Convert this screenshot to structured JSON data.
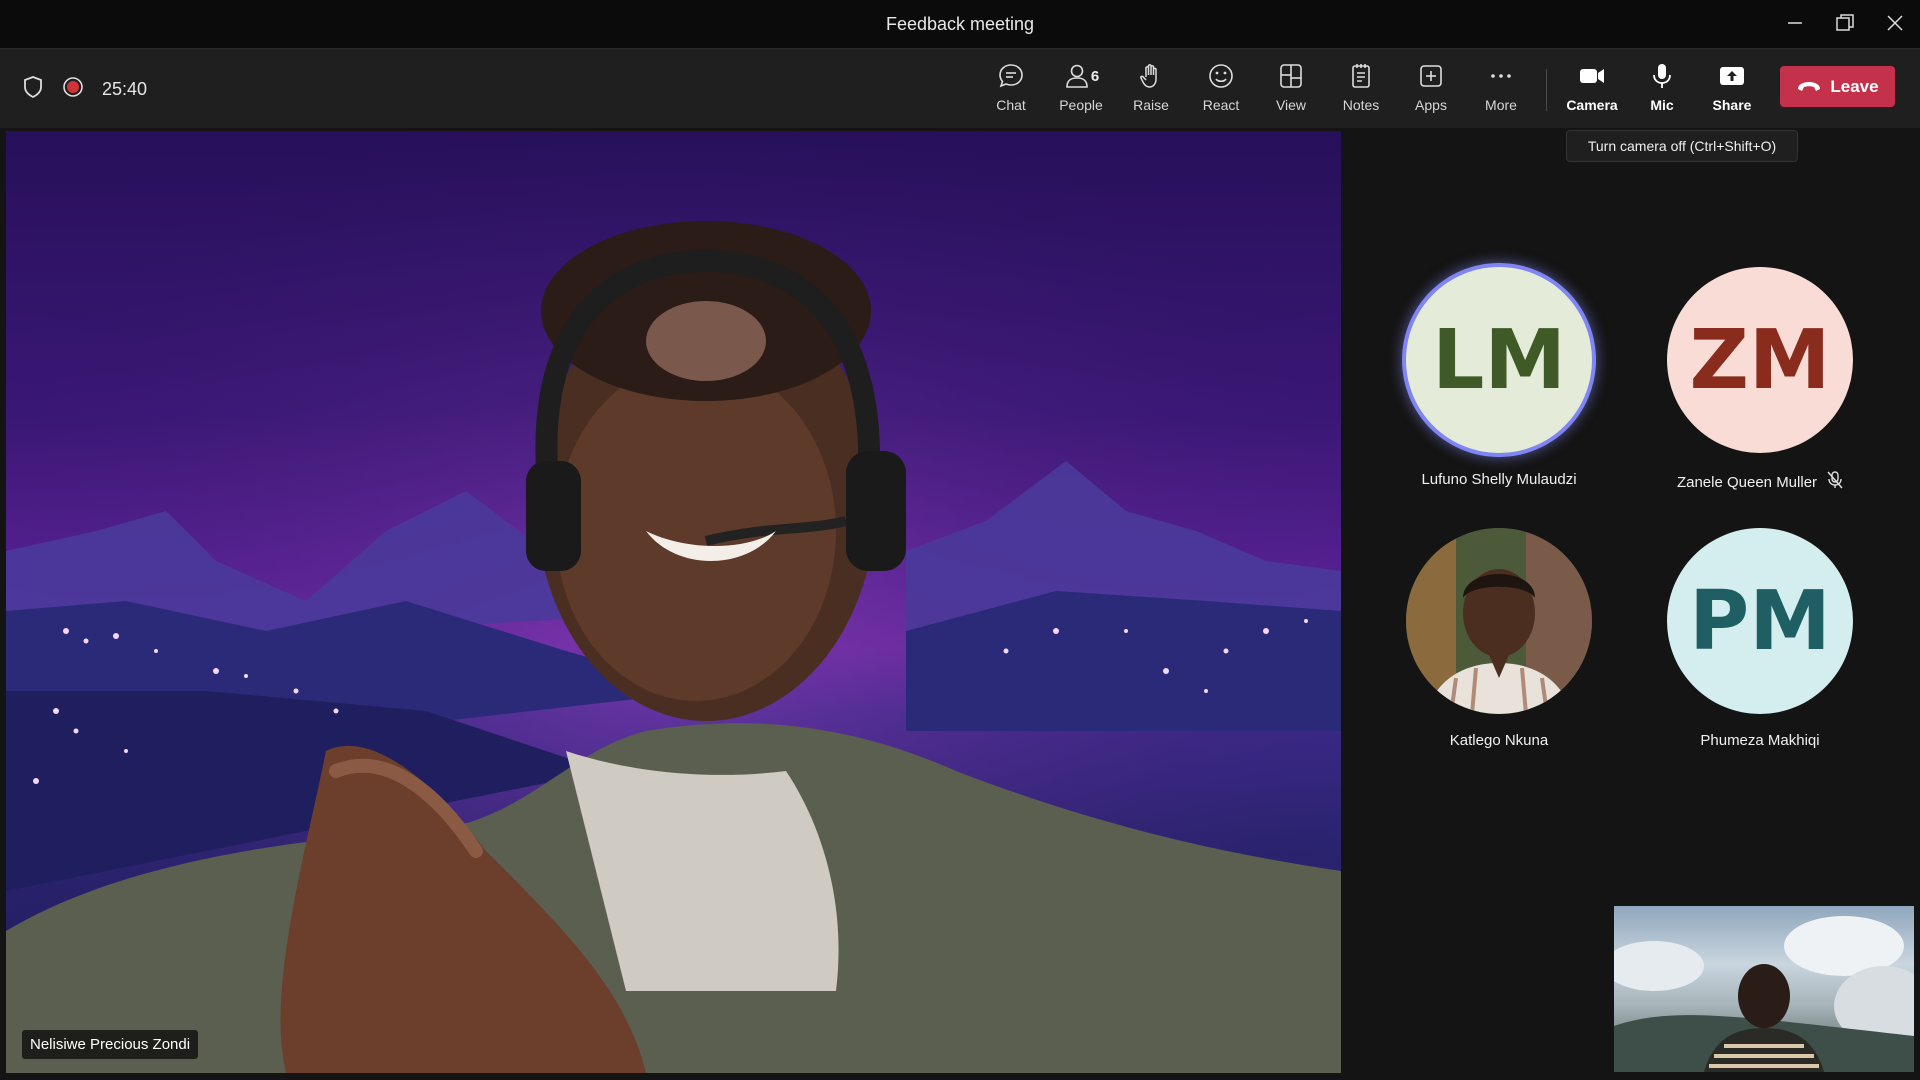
{
  "window": {
    "title": "Feedback meeting"
  },
  "toolbar": {
    "timer": "25:40",
    "buttons": {
      "chat": "Chat",
      "people": "People",
      "people_count": "6",
      "raise": "Raise",
      "react": "React",
      "view": "View",
      "notes": "Notes",
      "apps": "Apps",
      "more": "More",
      "camera": "Camera",
      "mic": "Mic",
      "share": "Share"
    },
    "leave_label": "Leave",
    "tooltip": "Turn camera off (Ctrl+Shift+O)"
  },
  "main_video": {
    "participant_name": "Nelisiwe Precious Zondi"
  },
  "participants": [
    {
      "initials": "LM",
      "name": "Lufuno Shelly Mulaudzi",
      "speaking": true,
      "bg": "#e4ecd9",
      "fg": "#3f5a26"
    },
    {
      "initials": "ZM",
      "name": "Zanele Queen Muller",
      "muted": true,
      "bg": "#f8dcd5",
      "fg": "#8a2c1d"
    },
    {
      "initials": "",
      "name": "Katlego Nkuna",
      "photo": true
    },
    {
      "initials": "PM",
      "name": "Phumeza Makhiqi",
      "bg": "#d4eef0",
      "fg": "#1f5f63"
    }
  ],
  "colors": {
    "leave": "#c4314b",
    "speaking_ring": "#7f85f5",
    "recording": "#d13438"
  }
}
